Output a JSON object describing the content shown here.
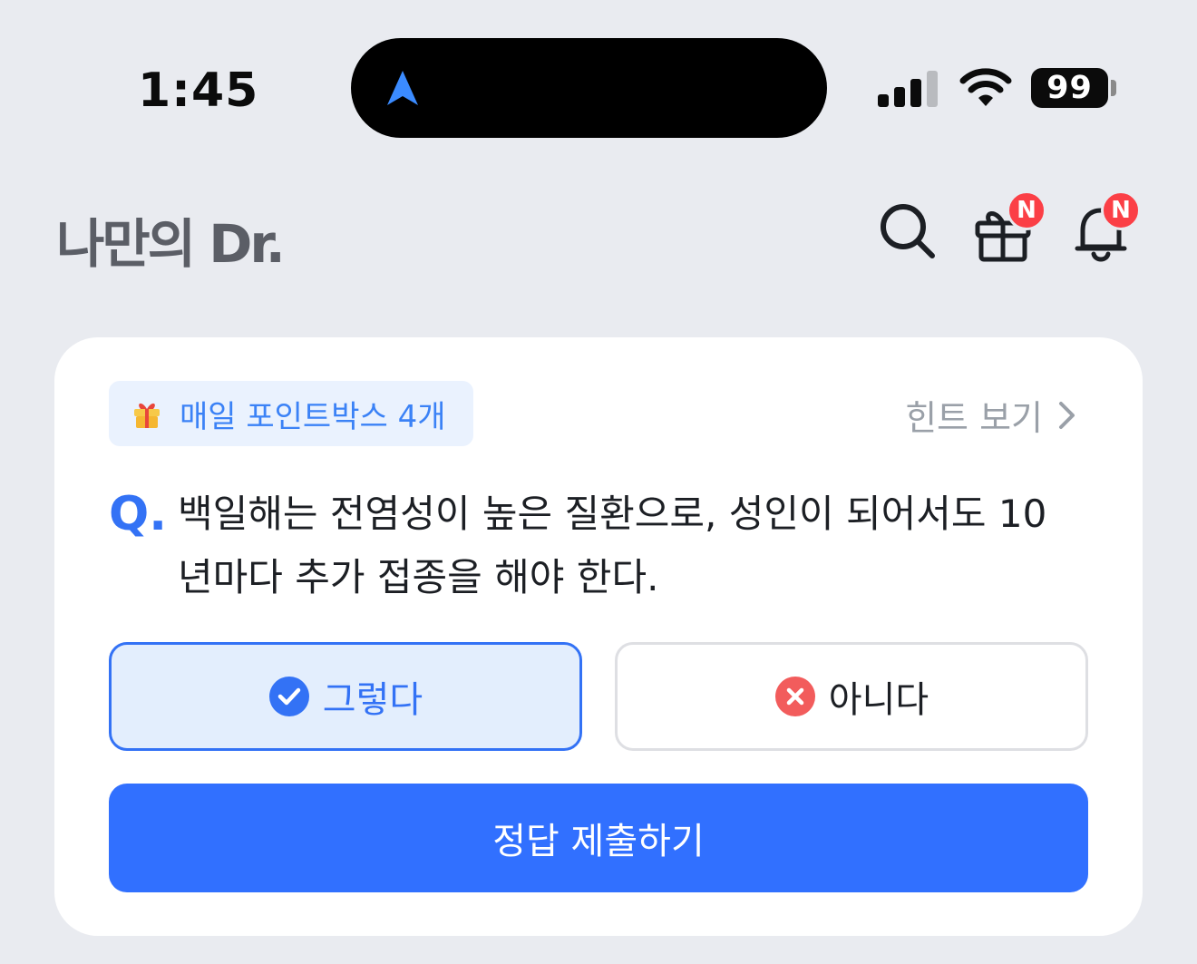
{
  "status_bar": {
    "time": "1:45",
    "battery": "99"
  },
  "header": {
    "logo": "나만의 Dr.",
    "gift_badge": "N",
    "bell_badge": "N"
  },
  "quiz": {
    "pointbox_label": "매일 포인트박스 4개",
    "hint_label": "힌트 보기",
    "question_prefix": "Q.",
    "question_text": "백일해는 전염성이 높은 질환으로, 성인이 되어서도 10년마다 추가 접종을 해야 한다.",
    "option_yes": "그렇다",
    "option_no": "아니다",
    "selected": "그렇다",
    "submit_label": "정답 제출하기"
  },
  "colors": {
    "accent": "#3372f5",
    "badge": "#fb3f46",
    "background": "#e9ebf0",
    "no_icon": "#f25c5c"
  }
}
